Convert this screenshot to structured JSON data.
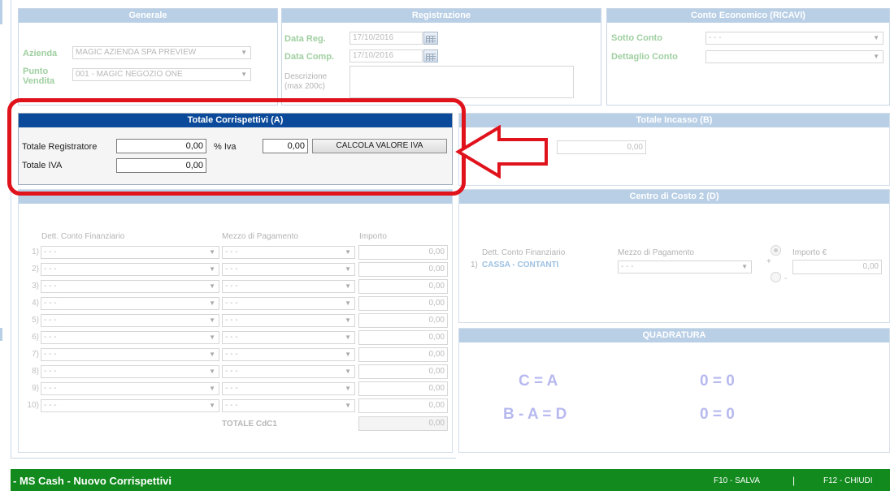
{
  "generale": {
    "title": "Generale",
    "azienda_label": "Azienda",
    "azienda_value": "MAGIC AZIENDA SPA PREVIEW",
    "punto_vendita_label": "Punto Vendita",
    "punto_vendita_value": "001 - MAGIC NEGOZIO ONE"
  },
  "registrazione": {
    "title": "Registrazione",
    "data_reg_label": "Data Reg.",
    "data_reg_value": "17/10/2016",
    "data_comp_label": "Data Comp.",
    "data_comp_value": "17/10/2016",
    "descrizione_label": "Descrizione (max 200c)"
  },
  "conto_economico": {
    "title": "Conto Economico (RICAVI)",
    "sotto_conto_label": "Sotto Conto",
    "sotto_conto_value": "- - -",
    "dettaglio_conto_label": "Dettaglio Conto",
    "dettaglio_conto_value": ""
  },
  "totale_corrispettivi": {
    "title": "Totale Corrispettivi (A)",
    "totale_registratore_label": "Totale Registratore",
    "totale_registratore_value": "0,00",
    "iva_pct_label": "% Iva",
    "iva_pct_value": "0,00",
    "calcola_button": "CALCOLA VALORE IVA",
    "totale_iva_label": "Totale IVA",
    "totale_iva_value": "0,00"
  },
  "totale_incasso": {
    "title": "Totale Incasso (B)",
    "value": "0,00"
  },
  "cdc1": {
    "col_conto": "Dett. Conto Finanziario",
    "col_mezzo": "Mezzo di Pagamento",
    "col_importo": "Importo",
    "rows": [
      {
        "num": "1)",
        "conto": "- - -",
        "mezzo": "- - -",
        "importo": "0,00"
      },
      {
        "num": "2)",
        "conto": "- - -",
        "mezzo": "- - -",
        "importo": "0,00"
      },
      {
        "num": "3)",
        "conto": "- - -",
        "mezzo": "- - -",
        "importo": "0,00"
      },
      {
        "num": "4)",
        "conto": "- - -",
        "mezzo": "- - -",
        "importo": "0,00"
      },
      {
        "num": "5)",
        "conto": "- - -",
        "mezzo": "- - -",
        "importo": "0,00"
      },
      {
        "num": "6)",
        "conto": "- - -",
        "mezzo": "- - -",
        "importo": "0,00"
      },
      {
        "num": "7)",
        "conto": "- - -",
        "mezzo": "- - -",
        "importo": "0,00"
      },
      {
        "num": "8)",
        "conto": "- - -",
        "mezzo": "- - -",
        "importo": "0,00"
      },
      {
        "num": "9)",
        "conto": "- - -",
        "mezzo": "- - -",
        "importo": "0,00"
      },
      {
        "num": "10)",
        "conto": "- - -",
        "mezzo": "- - -",
        "importo": "0,00"
      }
    ],
    "totale_label": "TOTALE CdC1",
    "totale_value": "0,00"
  },
  "cdc2": {
    "title": "Centro di Costo 2 (D)",
    "col_conto": "Dett. Conto Finanziario",
    "col_mezzo": "Mezzo di Pagamento",
    "col_importo": "Importo €",
    "row_num": "1)",
    "row_conto": "CASSA - CONTANTI",
    "row_mezzo": "- - -",
    "plus": "+",
    "minus": "-",
    "importo_value": "0,00"
  },
  "quadratura": {
    "title": "QUADRATURA",
    "eq1": "C = A",
    "eq1_res": "0 = 0",
    "eq2": "B - A = D",
    "eq2_res": "0 = 0"
  },
  "footer": {
    "title": "- MS Cash - Nuovo Corrispettivi",
    "salva": "F10 - SALVA",
    "sep": "|",
    "chiudi": "F12 - CHIUDI"
  },
  "colors": {
    "highlight_red": "#e0131c",
    "footer_green": "#128a1d",
    "header_blue": "#0b4a9a"
  }
}
